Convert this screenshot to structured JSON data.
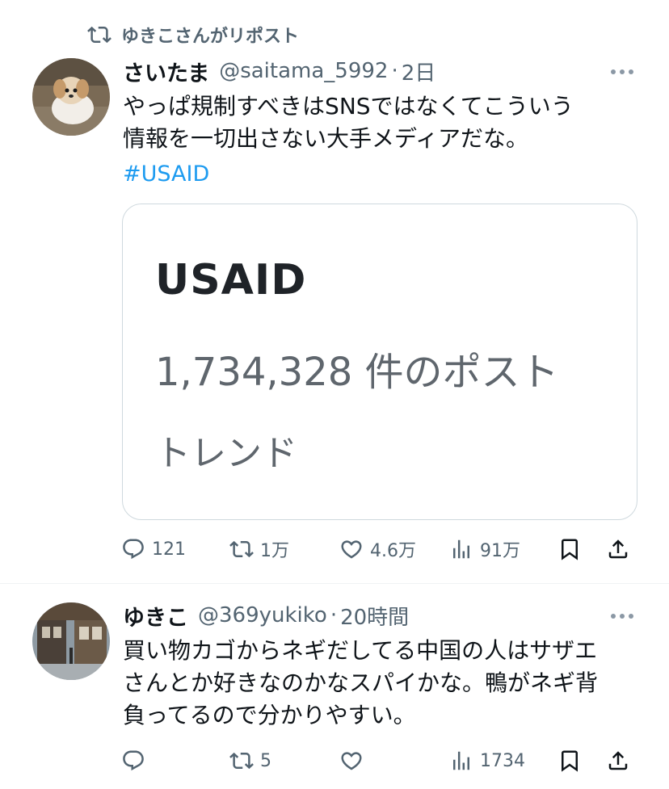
{
  "repost_banner": {
    "text": "ゆきこさんがリポスト",
    "icon": "repost-icon"
  },
  "tweets": [
    {
      "display_name": "さいたま",
      "handle": "@saitama_5992",
      "separator": "·",
      "time": "2日",
      "text_lines": [
        "やっぱ規制すべきはSNSではなくてこういう",
        "情報を一切出さない大手メディアだな。"
      ],
      "hashtag": "#USAID",
      "card": {
        "title": "USAID",
        "count_text": "1,734,328 件のポスト",
        "category": "トレンド"
      },
      "actions": {
        "replies": "121",
        "reposts": "1万",
        "likes": "4.6万",
        "views": "91万"
      }
    },
    {
      "display_name": "ゆきこ",
      "handle": "@369yukiko",
      "separator": "·",
      "time": "20時間",
      "text_lines": [
        "買い物カゴからネギだしてる中国の人はサザエ",
        "さんとか好きなのかなスパイかな。鴨がネギ背",
        "負ってるので分かりやすい。"
      ],
      "actions": {
        "replies": "",
        "reposts": "5",
        "likes": "",
        "views": "1734"
      }
    }
  ],
  "colors": {
    "accent": "#1d9bf0",
    "secondary_text": "#536471",
    "primary_text": "#0f1419",
    "border": "#cfd9de"
  }
}
